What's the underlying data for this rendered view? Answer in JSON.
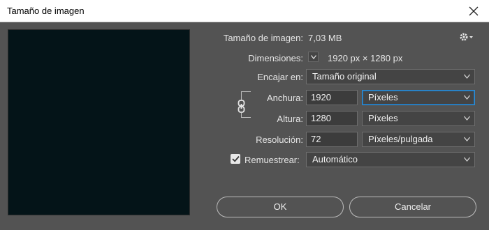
{
  "window": {
    "title": "Tamaño de imagen",
    "close_icon": "close-icon"
  },
  "info": {
    "size_label": "Tamaño de imagen:",
    "size_value": "7,03 MB",
    "dimensions_label": "Dimensiones:",
    "dimensions_value": "1920 px × 1280 px",
    "settings_icon": "gear-icon"
  },
  "fit": {
    "label": "Encajar en:",
    "value": "Tamaño original"
  },
  "width": {
    "label": "Anchura:",
    "value": "1920",
    "unit": "Píxeles"
  },
  "height": {
    "label": "Altura:",
    "value": "1280",
    "unit": "Píxeles"
  },
  "link_icon": "chain-link-icon",
  "resolution": {
    "label": "Resolución:",
    "value": "72",
    "unit": "Píxeles/pulgada"
  },
  "resample": {
    "checked": true,
    "label": "Remuestrear:",
    "value": "Automático"
  },
  "buttons": {
    "ok": "OK",
    "cancel": "Cancelar"
  },
  "colors": {
    "background": "#535353",
    "focus_border": "#2f8ed4"
  }
}
